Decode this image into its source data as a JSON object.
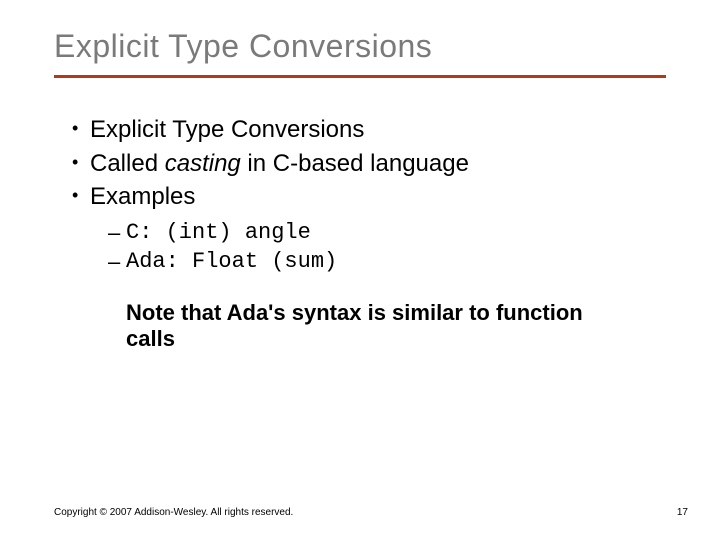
{
  "title": "Explicit Type Conversions",
  "bullets": {
    "b0": "Explicit Type Conversions",
    "b1_pre": "Called ",
    "b1_em": "casting",
    "b1_post": " in C-based language",
    "b2": "Examples"
  },
  "examples": {
    "e0": "C: (int) angle",
    "e1": "Ada: Float (sum)"
  },
  "note": "Note that Ada's syntax is similar to function calls",
  "footer": "Copyright © 2007 Addison-Wesley. All rights reserved.",
  "page": "17"
}
